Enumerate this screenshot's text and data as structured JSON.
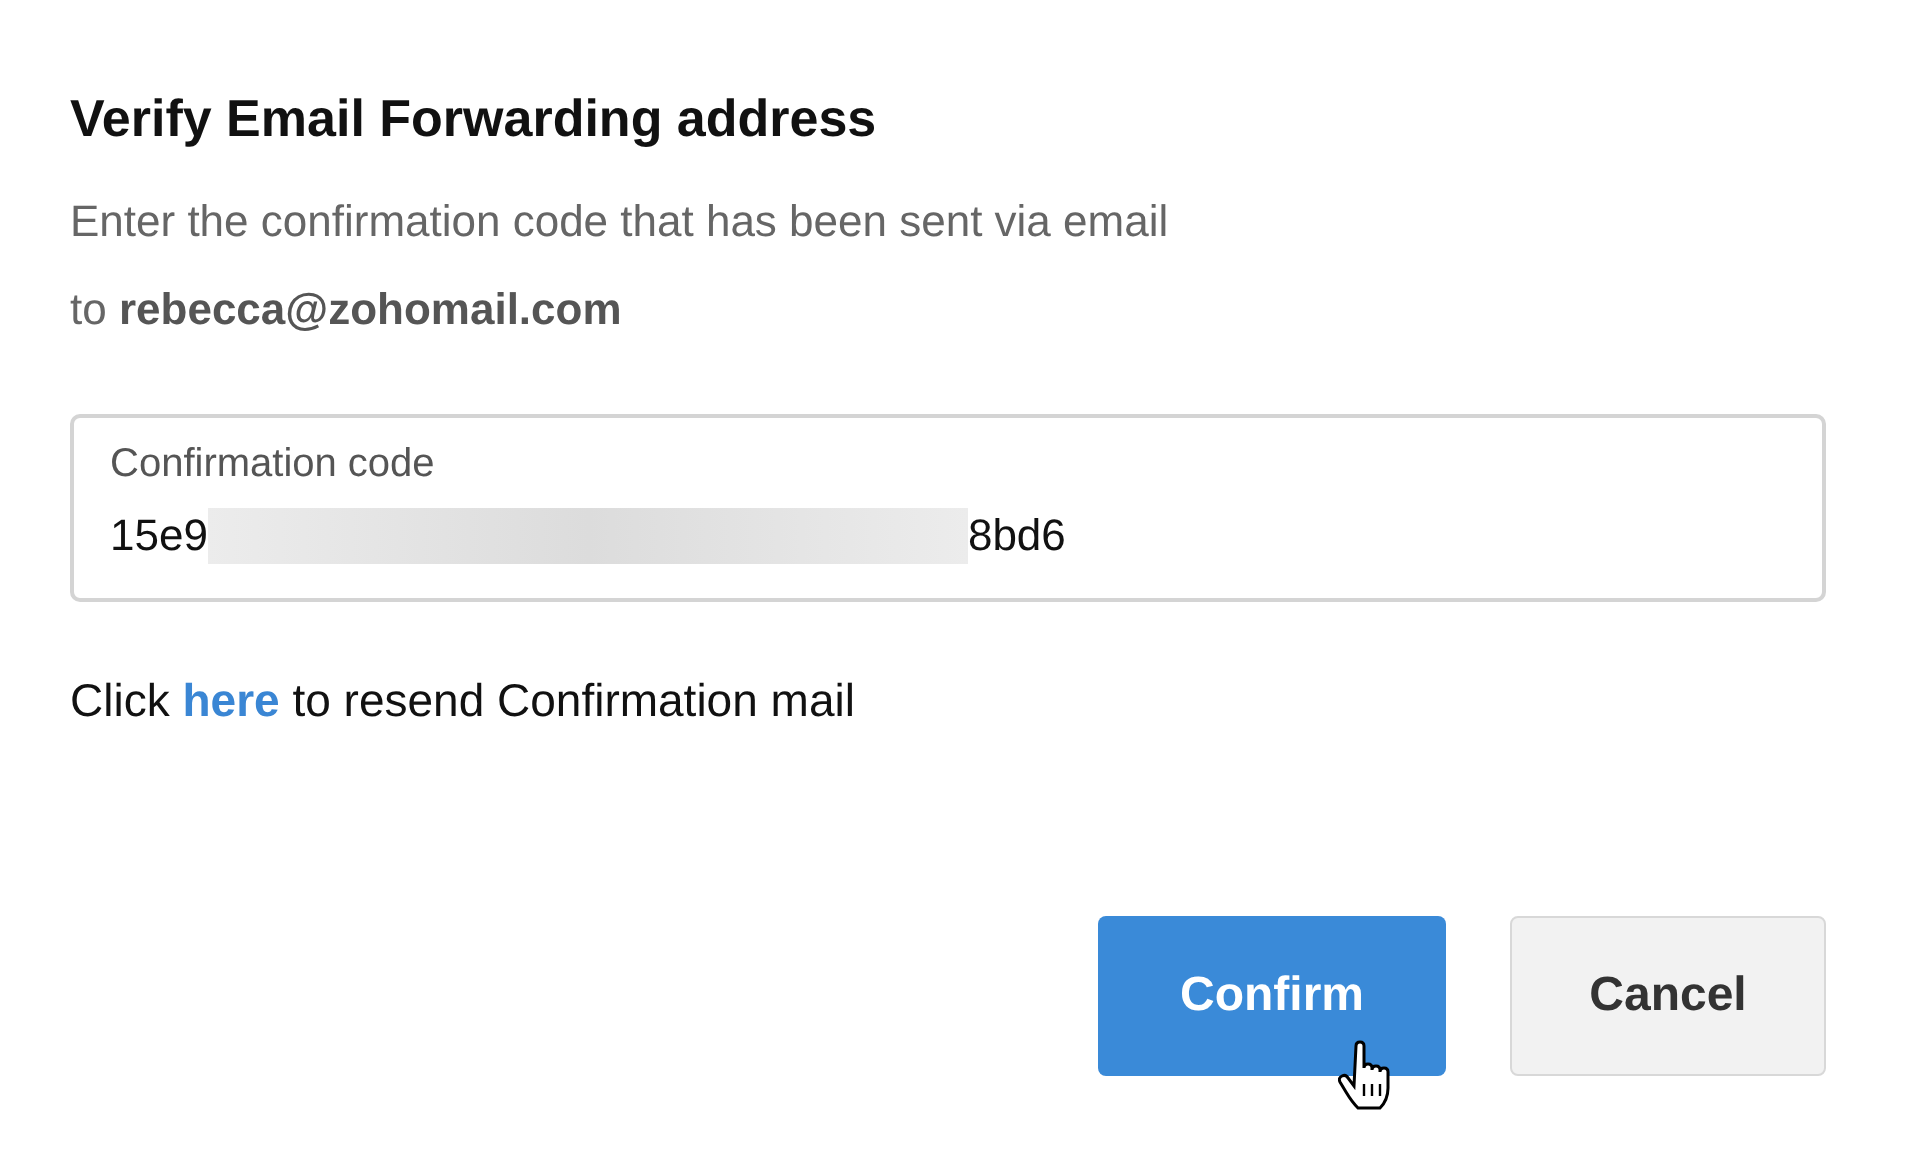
{
  "dialog": {
    "title": "Verify Email Forwarding address",
    "description_lines": [
      "Enter the confirmation code that has been sent via email",
      "to **rebecca@zohomail.com**"
    ],
    "code_field": {
      "label": "Confirmation code",
      "value_start": "15e9",
      "value_end": "8bd6",
      "redacted": true
    },
    "resend": {
      "before": "Click ",
      "link": "here",
      "after": " to resend Confirmation mail"
    },
    "buttons": [
      {
        "label": "Confirm",
        "kind": "primary",
        "hovered": true
      },
      {
        "label": "Cancel",
        "kind": "secondary",
        "hovered": false
      }
    ]
  }
}
